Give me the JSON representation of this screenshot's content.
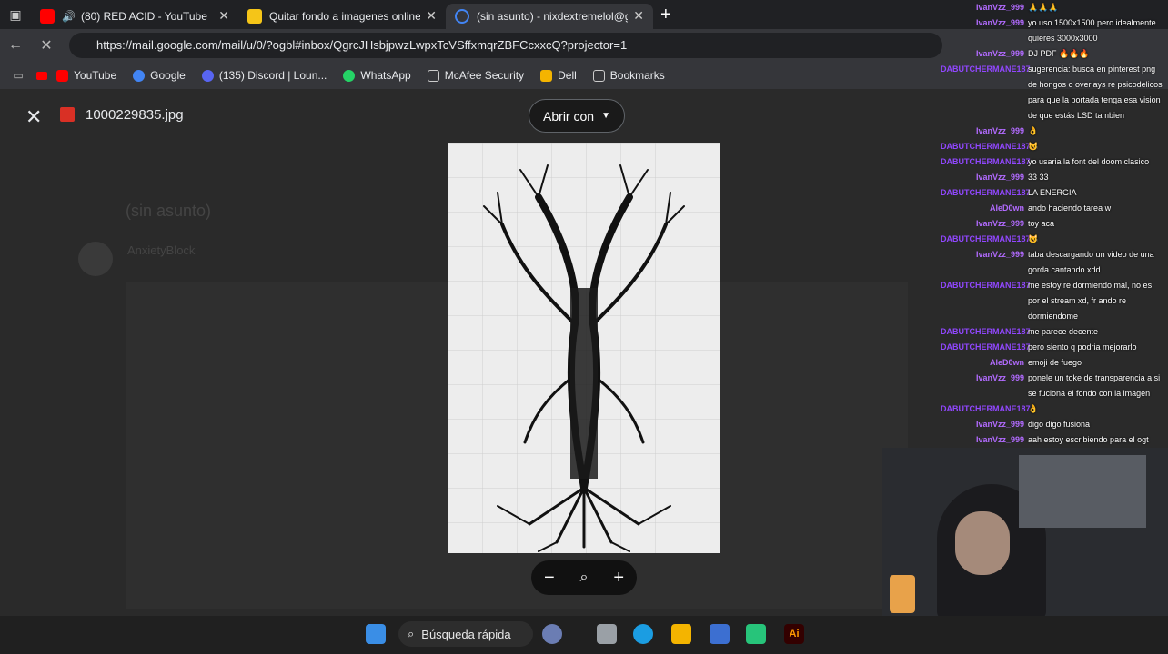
{
  "tabs": [
    {
      "title": "(80) RED ACID - YouTube",
      "fav": "#ff0000"
    },
    {
      "title": "Quitar fondo a imagenes online y",
      "fav": "#f5c518"
    },
    {
      "title": "(sin asunto) - nixdextremelol@gm",
      "fav": "#4285f4"
    }
  ],
  "address": {
    "url": "https://mail.google.com/mail/u/0/?ogbl#inbox/QgrcJHsbjpwzLwpxTcVSffxmqrZBFCcxxcQ?projector=1"
  },
  "bookmarks": [
    {
      "label": "YouTube",
      "color": "#ff0000"
    },
    {
      "label": "Google",
      "color": "#4285f4"
    },
    {
      "label": "(135) Discord | Loun...",
      "color": "#5865f2"
    },
    {
      "label": "WhatsApp",
      "color": "#25d366"
    },
    {
      "label": "McAfee Security",
      "color": "#888888"
    },
    {
      "label": "Dell",
      "color": "#f4b400"
    },
    {
      "label": "Bookmarks",
      "color": "#888888"
    }
  ],
  "viewer": {
    "filename": "1000229835.jpg",
    "open_with": "Abrir con",
    "subject": "(sin asunto)",
    "sender": "AnxietyBlock"
  },
  "taskbar": {
    "search": "Búsqueda rápida"
  },
  "chat": [
    {
      "user": "IvanVzz_999",
      "text": "🙏🙏🙏",
      "color": "#b26bff"
    },
    {
      "user": "IvanVzz_999",
      "text": "yo uso 1500x1500 pero idealmente quieres 3000x3000",
      "color": "#b26bff"
    },
    {
      "user": "IvanVzz_999",
      "text": "DJ PDF 🔥🔥🔥",
      "color": "#b26bff"
    },
    {
      "user": "DABUTCHERMANE187",
      "text": "sugerencia: busca en pinterest png de hongos o overlays re psicodelicos para que la portada tenga esa vision de que estás LSD tambien",
      "color": "#9147ff"
    },
    {
      "user": "IvanVzz_999",
      "text": "👌",
      "color": "#b26bff"
    },
    {
      "user": "DABUTCHERMANE187",
      "text": "😺",
      "color": "#9147ff"
    },
    {
      "user": "DABUTCHERMANE187",
      "text": "yo usaria la font del doom clasico",
      "color": "#9147ff"
    },
    {
      "user": "IvanVzz_999",
      "text": "33 33",
      "color": "#b26bff"
    },
    {
      "user": "DABUTCHERMANE187",
      "text": "LA ENERGIA",
      "color": "#9147ff"
    },
    {
      "user": "AleD0wn",
      "text": "ando haciendo tarea w",
      "color": "#b26bff"
    },
    {
      "user": "IvanVzz_999",
      "text": "toy aca",
      "color": "#b26bff"
    },
    {
      "user": "DABUTCHERMANE187",
      "text": "😺",
      "color": "#9147ff"
    },
    {
      "user": "IvanVzz_999",
      "text": "taba descargando un video de una gorda cantando xdd",
      "color": "#b26bff"
    },
    {
      "user": "DABUTCHERMANE187",
      "text": "me estoy re dormiendo mal, no es por el stream xd, fr ando re dormiendome",
      "color": "#9147ff"
    },
    {
      "user": "DABUTCHERMANE187",
      "text": "me parece decente",
      "color": "#9147ff"
    },
    {
      "user": "DABUTCHERMANE187",
      "text": "pero siento q podria mejorarlo",
      "color": "#9147ff"
    },
    {
      "user": "AleD0wn",
      "text": "emoji de fuego",
      "color": "#b26bff"
    },
    {
      "user": "IvanVzz_999",
      "text": "ponele un toke de transparencia a si se fuciona el fondo con la imagen",
      "color": "#b26bff"
    },
    {
      "user": "DABUTCHERMANE187",
      "text": "👌",
      "color": "#9147ff"
    },
    {
      "user": "IvanVzz_999",
      "text": "digo digo fusiona",
      "color": "#b26bff"
    },
    {
      "user": "IvanVzz_999",
      "text": "aah estoy escribiendo para el ogt",
      "color": "#b26bff"
    }
  ]
}
